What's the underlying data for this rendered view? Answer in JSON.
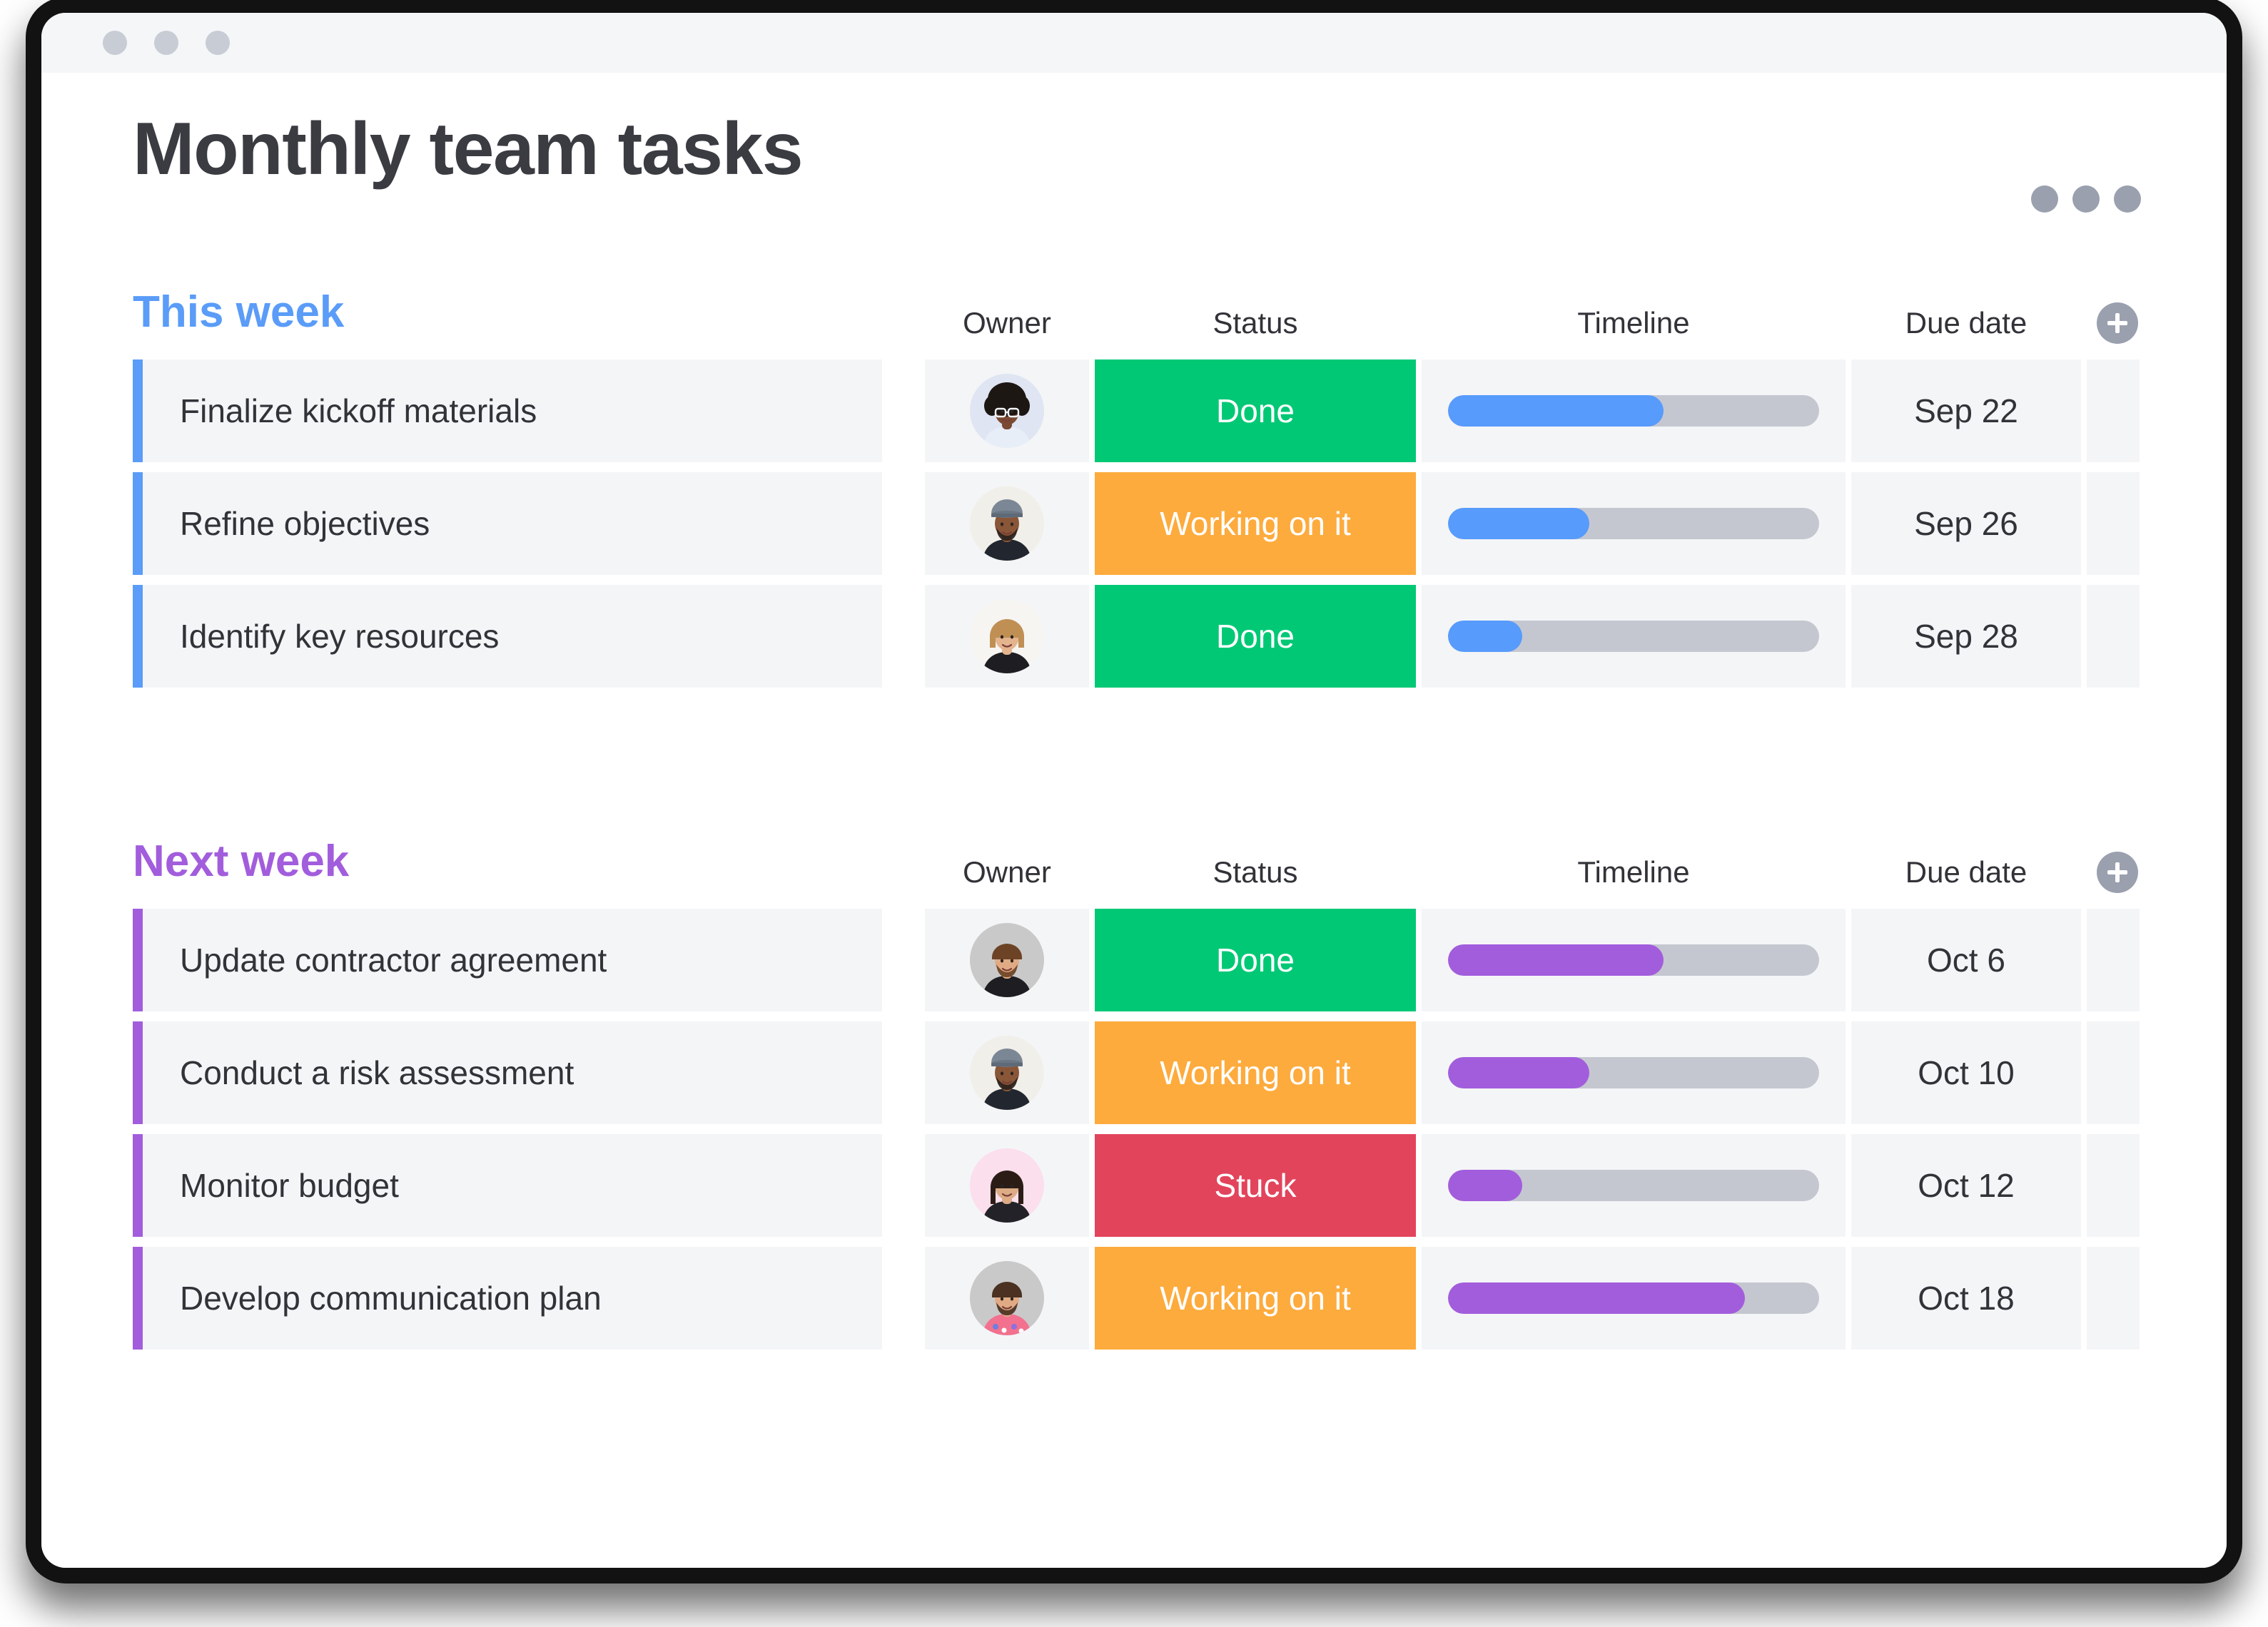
{
  "window": {
    "dots": [
      "window-dot-1",
      "window-dot-2",
      "window-dot-3"
    ],
    "dot_color": "#c8ccd4"
  },
  "header": {
    "title": "Monthly team tasks",
    "more_menu_icon": "more-horizontal-icon"
  },
  "columns": {
    "owner": "Owner",
    "status": "Status",
    "timeline": "Timeline",
    "due_date": "Due date",
    "add_column_icon": "plus-icon"
  },
  "colors": {
    "this_week_accent": "#5a9cf8",
    "next_week_accent": "#a25ddc",
    "status_done": "#00c875",
    "status_working": "#fdab3d",
    "status_stuck": "#e2445c",
    "timeline_track": "#c5c7d0",
    "row_background": "#f4f5f7",
    "title_text": "#3a3c42"
  },
  "groups": [
    {
      "id": "this-week",
      "title": "This week",
      "accent": "#5a9cf8",
      "rows": [
        {
          "task": "Finalize kickoff materials",
          "owner": "avatar-woman-glasses",
          "status": "Done",
          "status_kind": "done",
          "timeline_percent": 58,
          "due_date": "Sep 22"
        },
        {
          "task": "Refine objectives",
          "owner": "avatar-man-cap",
          "status": "Working on it",
          "status_kind": "working",
          "timeline_percent": 38,
          "due_date": "Sep 26"
        },
        {
          "task": "Identify key resources",
          "owner": "avatar-woman-blonde",
          "status": "Done",
          "status_kind": "done",
          "timeline_percent": 20,
          "due_date": "Sep 28"
        }
      ]
    },
    {
      "id": "next-week",
      "title": "Next week",
      "accent": "#a25ddc",
      "rows": [
        {
          "task": "Update contractor agreement",
          "owner": "avatar-man-brown-hair",
          "status": "Done",
          "status_kind": "done",
          "timeline_percent": 58,
          "due_date": "Oct 6"
        },
        {
          "task": "Conduct a risk assessment",
          "owner": "avatar-man-cap",
          "status": "Working on it",
          "status_kind": "working",
          "timeline_percent": 38,
          "due_date": "Oct 10"
        },
        {
          "task": "Monitor budget",
          "owner": "avatar-woman-dark-hair",
          "status": "Stuck",
          "status_kind": "stuck",
          "timeline_percent": 20,
          "due_date": "Oct 12"
        },
        {
          "task": "Develop communication plan",
          "owner": "avatar-man-beard-floral",
          "status": "Working on it",
          "status_kind": "working",
          "timeline_percent": 80,
          "due_date": "Oct 18"
        }
      ]
    }
  ]
}
